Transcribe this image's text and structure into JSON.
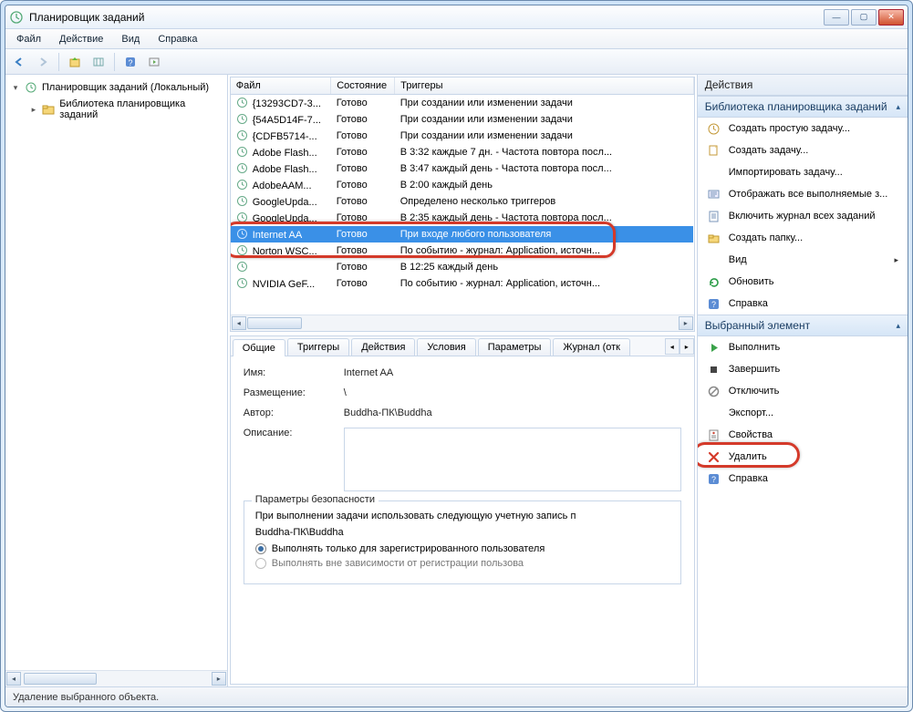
{
  "title": "Планировщик заданий",
  "menu": [
    "Файл",
    "Действие",
    "Вид",
    "Справка"
  ],
  "tree": {
    "root": "Планировщик заданий (Локальный)",
    "child": "Библиотека планировщика заданий"
  },
  "columns": {
    "c1": "Файл",
    "c2": "Состояние",
    "c3": "Триггеры"
  },
  "tasks": [
    {
      "name": "{13293CD7-3...",
      "state": "Готово",
      "trigger": "При создании или изменении задачи"
    },
    {
      "name": "{54A5D14F-7...",
      "state": "Готово",
      "trigger": "При создании или изменении задачи"
    },
    {
      "name": "{CDFB5714-...",
      "state": "Готово",
      "trigger": "При создании или изменении задачи"
    },
    {
      "name": "Adobe Flash...",
      "state": "Готово",
      "trigger": "В 3:32 каждые 7 дн. - Частота повтора посл..."
    },
    {
      "name": "Adobe Flash...",
      "state": "Готово",
      "trigger": "В 3:47 каждый день - Частота повтора посл..."
    },
    {
      "name": "AdobeAAM...",
      "state": "Готово",
      "trigger": "В 2:00 каждый день"
    },
    {
      "name": "GoogleUpda...",
      "state": "Готово",
      "trigger": "Определено несколько триггеров"
    },
    {
      "name": "GoogleUpda...",
      "state": "Готово",
      "trigger": "В 2:35 каждый день - Частота повтора посл..."
    },
    {
      "name": "Internet AA",
      "state": "Готово",
      "trigger": "При входе любого пользователя"
    },
    {
      "name": "Norton WSC...",
      "state": "Готово",
      "trigger": "По событию - журнал: Application, источн..."
    },
    {
      "name": "",
      "state": "Готово",
      "trigger": "В 12:25 каждый день"
    },
    {
      "name": "NVIDIA GeF...",
      "state": "Готово",
      "trigger": "По событию - журнал: Application, источн..."
    }
  ],
  "selected_index": 8,
  "tabs": [
    "Общие",
    "Триггеры",
    "Действия",
    "Условия",
    "Параметры",
    "Журнал (отк"
  ],
  "active_tab": 0,
  "detail": {
    "name_lbl": "Имя:",
    "name_val": "Internet AA",
    "loc_lbl": "Размещение:",
    "loc_val": "\\",
    "author_lbl": "Автор:",
    "author_val": "Buddha-ПК\\Buddha",
    "desc_lbl": "Описание:",
    "sec_group": "Параметры безопасности",
    "sec_text": "При выполнении задачи использовать следующую учетную запись п",
    "sec_acct": "Buddha-ПК\\Buddha",
    "radio1": "Выполнять только для зарегистрированного пользователя",
    "radio2": "Выполнять вне зависимости от регистрации пользова"
  },
  "actions_header": "Действия",
  "section1": {
    "title": "Библиотека планировщика заданий",
    "items": [
      {
        "label": "Создать простую задачу...",
        "icon": "clock"
      },
      {
        "label": "Создать задачу...",
        "icon": "new"
      },
      {
        "label": "Импортировать задачу...",
        "icon": ""
      },
      {
        "label": "Отображать все выполняемые з...",
        "icon": "display"
      },
      {
        "label": "Включить журнал всех заданий",
        "icon": "journal"
      },
      {
        "label": "Создать папку...",
        "icon": "folder"
      },
      {
        "label": "Вид",
        "icon": "",
        "arrow": true
      },
      {
        "label": "Обновить",
        "icon": "refresh"
      },
      {
        "label": "Справка",
        "icon": "help"
      }
    ]
  },
  "section2": {
    "title": "Выбранный элемент",
    "items": [
      {
        "label": "Выполнить",
        "icon": "run"
      },
      {
        "label": "Завершить",
        "icon": "stop"
      },
      {
        "label": "Отключить",
        "icon": "disable"
      },
      {
        "label": "Экспорт...",
        "icon": ""
      },
      {
        "label": "Свойства",
        "icon": "props"
      },
      {
        "label": "Удалить",
        "icon": "delete",
        "highlight": true
      },
      {
        "label": "Справка",
        "icon": "help"
      }
    ]
  },
  "statusbar": "Удаление выбранного объекта."
}
